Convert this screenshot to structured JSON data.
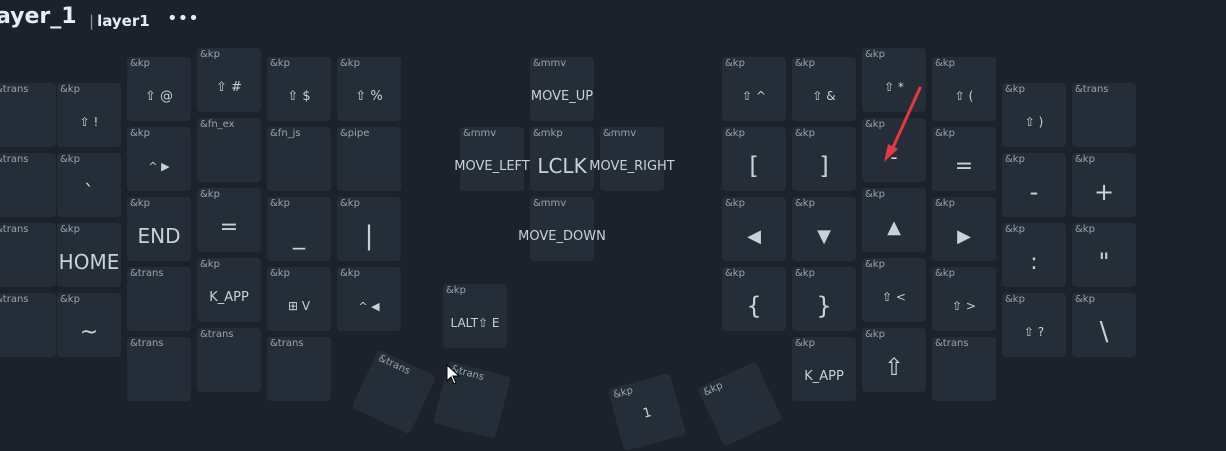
{
  "header": {
    "title": "ayer_1",
    "separator": "|",
    "layer_name": "layer1",
    "more_label": "•••"
  },
  "keys": [
    {
      "id": "k-l0-0",
      "type": "&trans",
      "label": ""
    },
    {
      "id": "k-l0-1",
      "type": "&trans",
      "label": ""
    },
    {
      "id": "k-l0-2",
      "type": "&trans",
      "label": ""
    },
    {
      "id": "k-l0-3",
      "type": "&trans",
      "label": ""
    },
    {
      "id": "k-l1-0",
      "type": "&kp",
      "label": "⇧ !"
    },
    {
      "id": "k-l1-1",
      "type": "&kp",
      "label": "`"
    },
    {
      "id": "k-l1-2",
      "type": "&kp",
      "label": "HOME"
    },
    {
      "id": "k-l1-3",
      "type": "&kp",
      "label": "~"
    },
    {
      "id": "k-l2-0",
      "type": "&kp",
      "label": "⇧ @"
    },
    {
      "id": "k-l2-1",
      "type": "&kp",
      "label": "^ ▶"
    },
    {
      "id": "k-l2-2",
      "type": "&kp",
      "label": "END"
    },
    {
      "id": "k-l2-3",
      "type": "&trans",
      "label": ""
    },
    {
      "id": "k-l2-4",
      "type": "&trans",
      "label": ""
    },
    {
      "id": "k-l3-0",
      "type": "&kp",
      "label": "⇧ #"
    },
    {
      "id": "k-l3-1",
      "type": "&fn_ex",
      "label": ""
    },
    {
      "id": "k-l3-2",
      "type": "&kp",
      "label": "="
    },
    {
      "id": "k-l3-3",
      "type": "&kp",
      "label": "K_APP"
    },
    {
      "id": "k-l3-4",
      "type": "&trans",
      "label": ""
    },
    {
      "id": "k-l4-0",
      "type": "&kp",
      "label": "⇧ $"
    },
    {
      "id": "k-l4-1",
      "type": "&fn_js",
      "label": ""
    },
    {
      "id": "k-l4-2",
      "type": "&kp",
      "label": "_"
    },
    {
      "id": "k-l4-3",
      "type": "&kp",
      "label": "⊞ V"
    },
    {
      "id": "k-l4-4",
      "type": "&trans",
      "label": ""
    },
    {
      "id": "k-l5-0",
      "type": "&kp",
      "label": "⇧ %"
    },
    {
      "id": "k-l5-1",
      "type": "&pipe",
      "label": ""
    },
    {
      "id": "k-l5-2",
      "type": "&kp",
      "label": "|"
    },
    {
      "id": "k-l5-3",
      "type": "&kp",
      "label": "^ ◀"
    },
    {
      "id": "k-lalt",
      "type": "&kp",
      "label": "LALT⇧ E"
    },
    {
      "id": "k-mv-up",
      "type": "&mmv",
      "label": "MOVE_UP"
    },
    {
      "id": "k-mv-left",
      "type": "&mmv",
      "label": "MOVE_LEFT"
    },
    {
      "id": "k-lclk",
      "type": "&mkp",
      "label": "LCLK"
    },
    {
      "id": "k-mv-right",
      "type": "&mmv",
      "label": "MOVE_RIGHT"
    },
    {
      "id": "k-mv-down",
      "type": "&mmv",
      "label": "MOVE_DOWN"
    },
    {
      "id": "k-r0-0",
      "type": "&kp",
      "label": "⇧ ^"
    },
    {
      "id": "k-r0-1",
      "type": "&kp",
      "label": "["
    },
    {
      "id": "k-r0-2",
      "type": "&kp",
      "label": "◀"
    },
    {
      "id": "k-r0-3",
      "type": "&kp",
      "label": "{"
    },
    {
      "id": "k-r1-0",
      "type": "&kp",
      "label": "⇧ &"
    },
    {
      "id": "k-r1-1",
      "type": "&kp",
      "label": "]"
    },
    {
      "id": "k-r1-2",
      "type": "&kp",
      "label": "▼"
    },
    {
      "id": "k-r1-3",
      "type": "&kp",
      "label": "}"
    },
    {
      "id": "k-r1-4",
      "type": "&kp",
      "label": "K_APP"
    },
    {
      "id": "k-r2-0",
      "type": "&kp",
      "label": "⇧ *"
    },
    {
      "id": "k-r2-1",
      "type": "&kp",
      "label": "-"
    },
    {
      "id": "k-r2-2",
      "type": "&kp",
      "label": "▲"
    },
    {
      "id": "k-r2-3",
      "type": "&kp",
      "label": "⇧ <"
    },
    {
      "id": "k-r2-4",
      "type": "&kp",
      "label": "⇧"
    },
    {
      "id": "k-r3-0",
      "type": "&kp",
      "label": "⇧ ("
    },
    {
      "id": "k-r3-1",
      "type": "&kp",
      "label": "="
    },
    {
      "id": "k-r3-2",
      "type": "&kp",
      "label": "▶"
    },
    {
      "id": "k-r3-3",
      "type": "&kp",
      "label": "⇧ >"
    },
    {
      "id": "k-r3-4",
      "type": "&trans",
      "label": ""
    },
    {
      "id": "k-r4-0",
      "type": "&kp",
      "label": "⇧ )"
    },
    {
      "id": "k-r4-1",
      "type": "&kp",
      "label": "-"
    },
    {
      "id": "k-r4-2",
      "type": "&kp",
      "label": ":"
    },
    {
      "id": "k-r4-3",
      "type": "&kp",
      "label": "⇧ ?"
    },
    {
      "id": "k-r5-0",
      "type": "&trans",
      "label": ""
    },
    {
      "id": "k-r5-1",
      "type": "&kp",
      "label": "+"
    },
    {
      "id": "k-r5-2",
      "type": "&kp",
      "label": "\""
    },
    {
      "id": "k-r5-3",
      "type": "&kp",
      "label": "\\"
    }
  ],
  "thumbs": [
    {
      "id": "t-1",
      "type": "&trans",
      "label": ""
    },
    {
      "id": "t-2",
      "type": "&trans",
      "label": ""
    },
    {
      "id": "t-3",
      "type": "&kp",
      "label": "1"
    },
    {
      "id": "t-4",
      "type": "&kp",
      "label": ""
    }
  ]
}
